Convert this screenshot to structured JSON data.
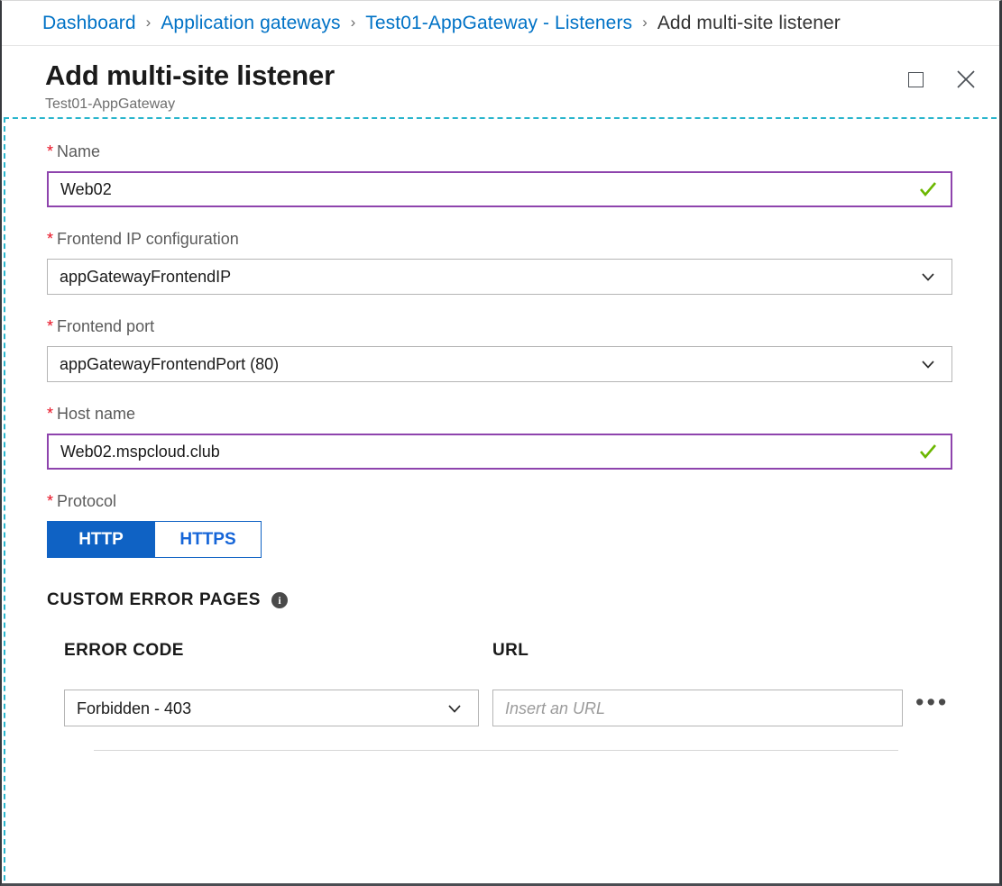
{
  "breadcrumb": {
    "separator": "›",
    "items": [
      {
        "label": "Dashboard",
        "current": false
      },
      {
        "label": "Application gateways",
        "current": false
      },
      {
        "label": "Test01-AppGateway - Listeners",
        "current": false
      },
      {
        "label": "Add multi-site listener",
        "current": true
      }
    ]
  },
  "header": {
    "title": "Add multi-site listener",
    "subtitle": "Test01-AppGateway",
    "maximize_label": "Maximize",
    "close_label": "Close"
  },
  "form": {
    "name": {
      "label": "Name",
      "required_marker": "*",
      "value": "Web02",
      "valid": true
    },
    "frontend_ip": {
      "label": "Frontend IP configuration",
      "required_marker": "*",
      "value": "appGatewayFrontendIP"
    },
    "frontend_port": {
      "label": "Frontend port",
      "required_marker": "*",
      "value": "appGatewayFrontendPort (80)"
    },
    "host_name": {
      "label": "Host name",
      "required_marker": "*",
      "value": "Web02.mspcloud.club",
      "valid": true
    },
    "protocol": {
      "label": "Protocol",
      "required_marker": "*",
      "options": [
        {
          "label": "HTTP",
          "selected": true
        },
        {
          "label": "HTTPS",
          "selected": false
        }
      ]
    }
  },
  "custom_error_pages": {
    "section_title": "CUSTOM ERROR PAGES",
    "info_glyph": "i",
    "columns": {
      "error_code": "ERROR CODE",
      "url": "URL"
    },
    "rows": [
      {
        "error_code": "Forbidden - 403",
        "url_value": "",
        "url_placeholder": "Insert an URL",
        "more_label": "•••"
      }
    ]
  },
  "colors": {
    "link": "#0072c6",
    "valid_border": "#8e44ad",
    "valid_check": "#6bb700",
    "accent_blue": "#0f62c4",
    "required_red": "#e81123",
    "focus_dash": "#29b5cc"
  }
}
